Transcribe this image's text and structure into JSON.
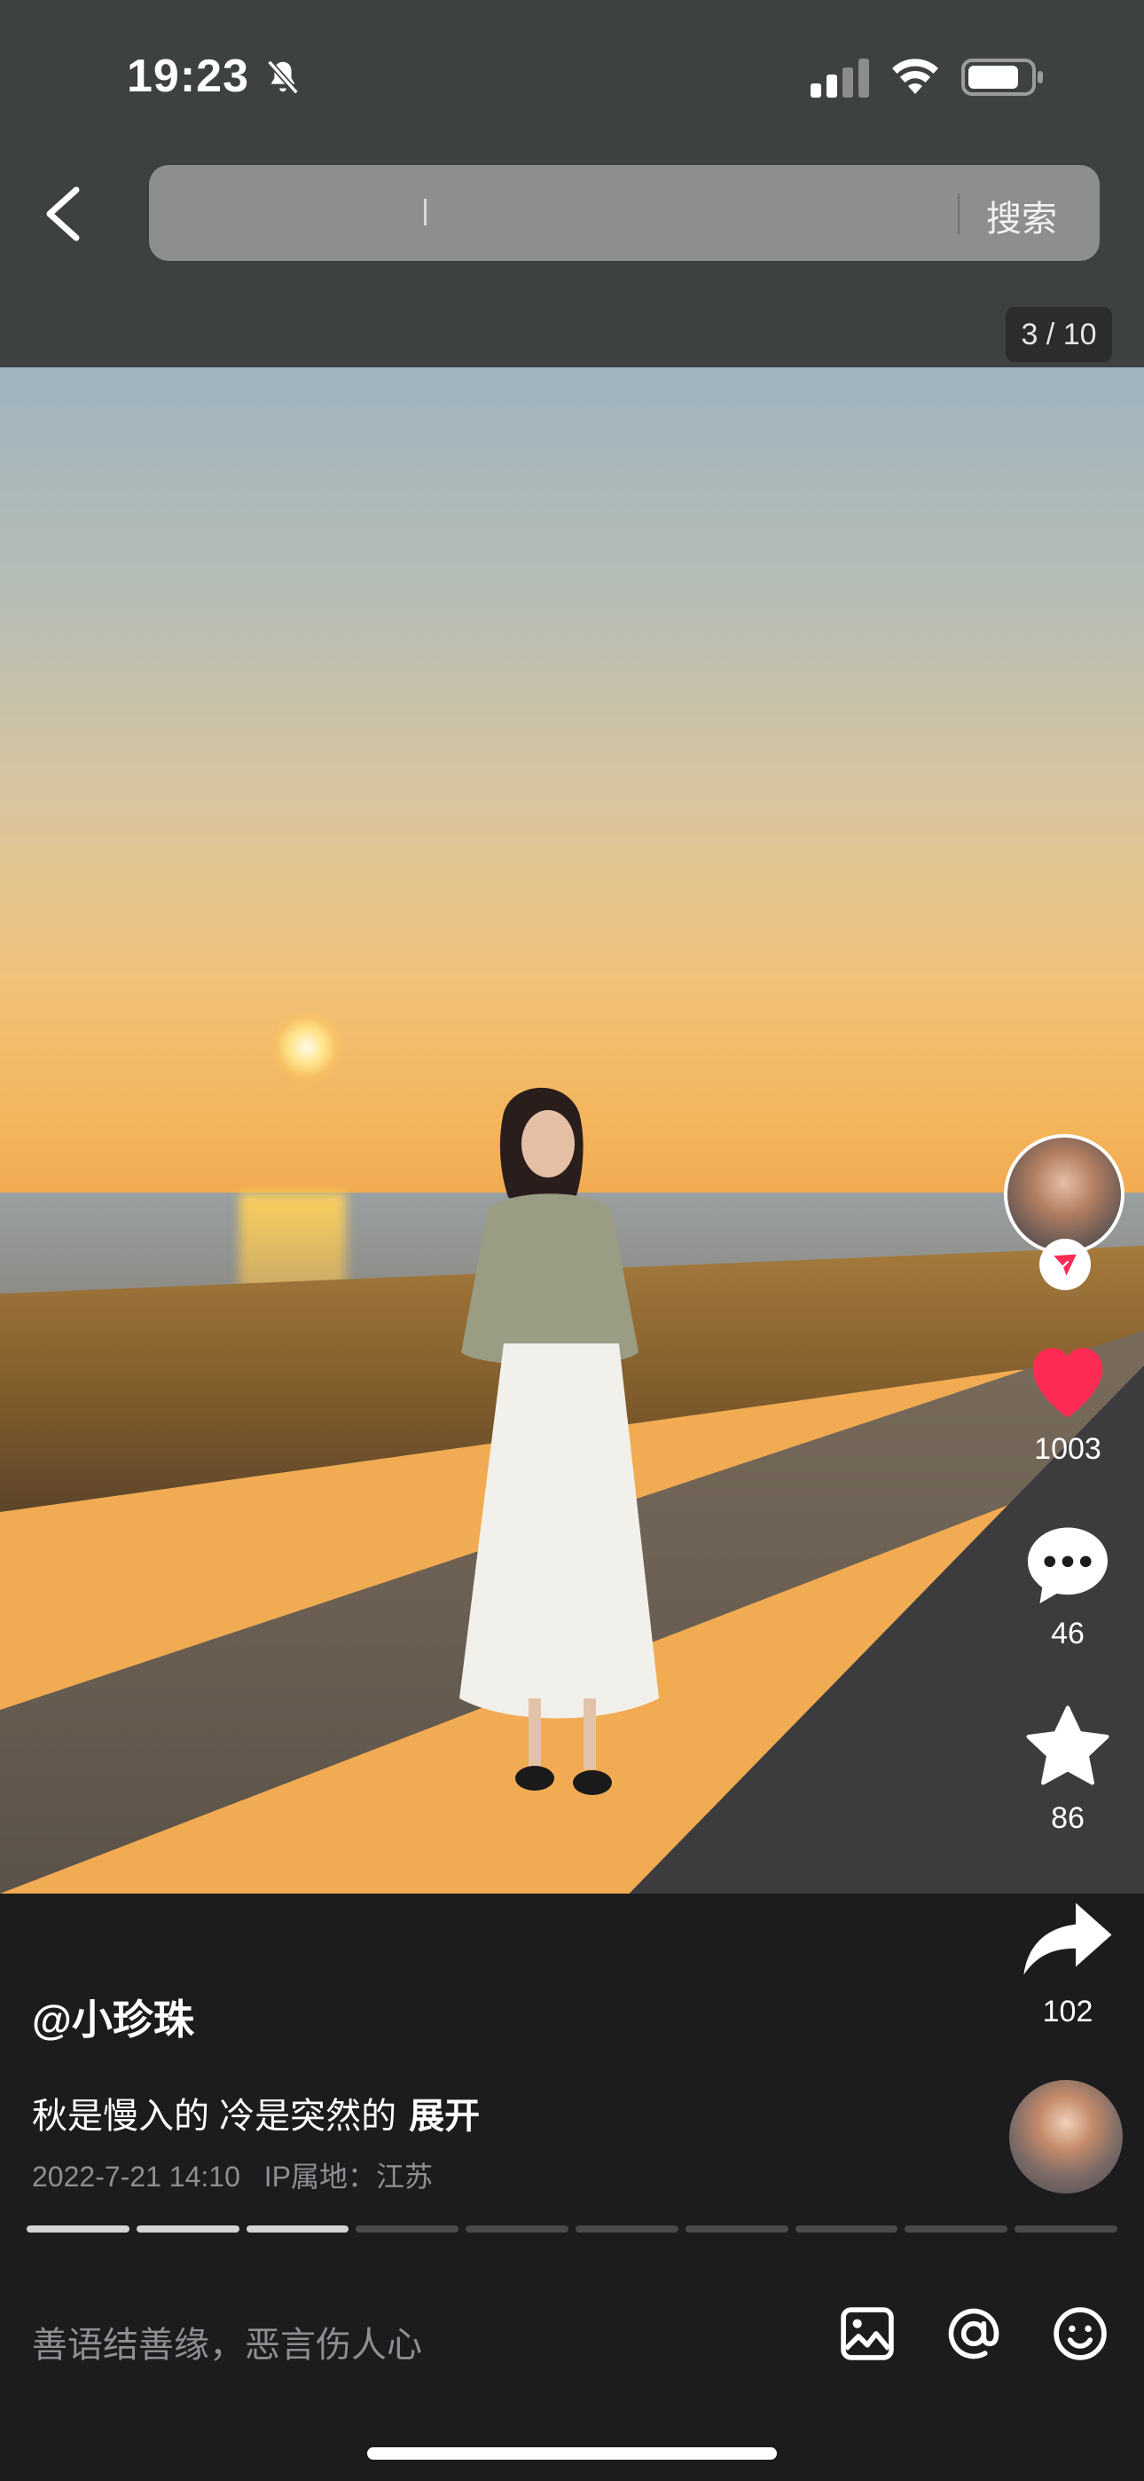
{
  "status_bar": {
    "time": "19:23",
    "icons": [
      "bell-slash-icon",
      "signal-icon",
      "wifi-icon",
      "battery-icon"
    ]
  },
  "search": {
    "button_label": "搜索",
    "value": ""
  },
  "gallery": {
    "counter": "3 / 10",
    "current": 3,
    "total": 10
  },
  "actions": {
    "likes": "1003",
    "comments": "46",
    "favorites": "86",
    "shares": "102"
  },
  "post": {
    "username": "@小珍珠",
    "caption": "秋是慢入的 冷是突然的",
    "expand_label": "展开",
    "date": "2022-7-21 14:10",
    "location": "IP属地：江苏"
  },
  "comment_box": {
    "placeholder": "善语结善缘，恶言伤人心"
  },
  "colors": {
    "like": "#fe2c55",
    "background": "#1c1c1e",
    "header": "#3e4142"
  }
}
